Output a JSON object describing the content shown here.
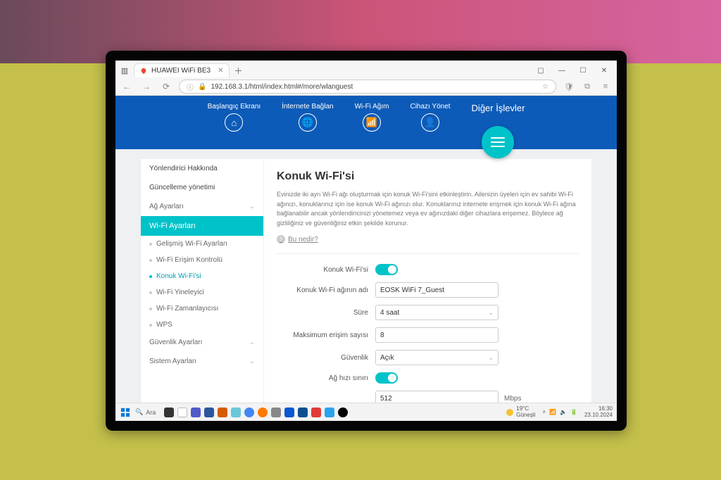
{
  "browser": {
    "tab_title": "HUAWEI WiFi BE3",
    "url": "192.168.3.1/html/index.html#/more/wlanguest"
  },
  "topnav": {
    "items": [
      {
        "label": "Başlangıç Ekranı"
      },
      {
        "label": "İnternete Bağlan"
      },
      {
        "label": "Wi-Fi Ağım"
      },
      {
        "label": "Cihazı Yönet"
      },
      {
        "label": "Diğer İşlevler"
      }
    ]
  },
  "sidebar": {
    "top": [
      {
        "label": "Yönlendirici Hakkında"
      },
      {
        "label": "Güncelleme yönetimi"
      },
      {
        "label": "Ağ Ayarları"
      }
    ],
    "active_header": "Wi-Fi Ayarları",
    "subs": [
      {
        "label": "Gelişmiş Wi-Fi Ayarları"
      },
      {
        "label": "Wi-Fi Erişim Kontrolü"
      },
      {
        "label": "Konuk Wi-Fi'si"
      },
      {
        "label": "Wi-Fi Yineleyici"
      },
      {
        "label": "Wi-Fi Zamanlayıcısı"
      },
      {
        "label": "WPS"
      }
    ],
    "bottom": [
      {
        "label": "Güvenlik Ayarları"
      },
      {
        "label": "Sistem Ayarları"
      }
    ]
  },
  "page": {
    "title": "Konuk Wi-Fi'si",
    "description": "Evinizde iki ayrı Wi-Fi ağı oluşturmak için konuk Wi-Fi'sini etkinleştirin. Ailenizin üyeleri için ev sahibi Wi-Fi ağınızı, konuklarınız için ise konuk Wi-Fi ağınızı olur. Konuklarınız internete erişmek için konuk Wi-Fi ağına bağlanabilir ancak yönlendiricinizi yönetemez veya ev ağınızdaki diğer cihazlara erişemez. Böylece ağ gizliliğiniz ve güvenliğiniz etkin şekilde korunur.",
    "help_link": "Bu nedir?"
  },
  "form": {
    "enable_label": "Konuk Wi-Fi'si",
    "ssid_label": "Konuk Wi-Fi ağının adı",
    "ssid_value": "EOSK WiFi 7_Guest",
    "duration_label": "Süre",
    "duration_value": "4 saat",
    "max_label": "Maksimum erişim sayısı",
    "max_value": "8",
    "security_label": "Güvenlik",
    "security_value": "Açık",
    "speedlimit_label": "Ağ hızı sınırı",
    "speed_value": "512",
    "speed_unit": "Mbps"
  },
  "taskbar": {
    "search": "Ara",
    "weather_temp": "19°C",
    "weather_text": "Güneşli",
    "time": "16:30",
    "date": "23.10.2024"
  }
}
